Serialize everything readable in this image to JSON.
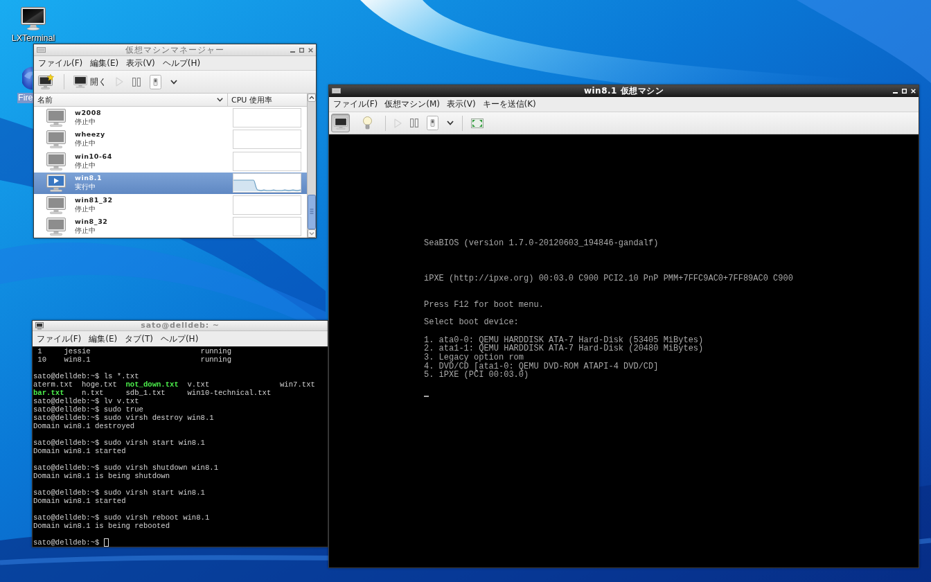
{
  "desktop_icons": [
    {
      "label": "LXTerminal",
      "kind": "terminal",
      "selected": false
    },
    {
      "label": "Fire",
      "kind": "browser",
      "selected": true
    }
  ],
  "vm_manager": {
    "title": "仮想マシンマネージャー",
    "menu": [
      "ファイル(F)",
      "編集(E)",
      "表示(V)",
      "ヘルプ(H)"
    ],
    "toolbar": [
      {
        "kind": "new",
        "disabled": false
      },
      {
        "kind": "open",
        "label": "開く",
        "disabled": false
      },
      {
        "kind": "run",
        "disabled": true
      },
      {
        "kind": "pause",
        "disabled": false
      },
      {
        "kind": "shutdown",
        "disabled": false
      },
      {
        "kind": "menu",
        "disabled": false
      }
    ],
    "columns": [
      "名前",
      "CPU 使用率"
    ],
    "vms": [
      {
        "name": "w2008",
        "status": "停止中",
        "running": false,
        "selected": false
      },
      {
        "name": "wheezy",
        "status": "停止中",
        "running": false,
        "selected": false
      },
      {
        "name": "win10-64",
        "status": "停止中",
        "running": false,
        "selected": false
      },
      {
        "name": "win8.1",
        "status": "実行中",
        "running": true,
        "selected": true
      },
      {
        "name": "win81_32",
        "status": "停止中",
        "running": false,
        "selected": false
      },
      {
        "name": "win8_32",
        "status": "停止中",
        "running": false,
        "selected": false
      }
    ]
  },
  "terminal": {
    "title": "sato@delldeb: ~",
    "menu": [
      "ファイル(F)",
      "編集(E)",
      "タブ(T)",
      "ヘルプ(H)"
    ],
    "blocks": [
      {
        "lines": [
          {
            "kind": "domain",
            "id": "1",
            "name": "jessie",
            "state": "running"
          },
          {
            "kind": "domain",
            "id": "10",
            "name": "win8.1",
            "state": "running"
          }
        ]
      },
      {
        "lines": [
          {
            "kind": "text",
            "text": "sato@delldeb:~$ ls *.txt"
          },
          {
            "kind": "listing",
            "files": [
              {
                "name": "aterm.txt",
                "executable": false
              },
              {
                "name": "hoge.txt",
                "executable": false
              },
              {
                "name": "not_down.txt",
                "executable": true
              },
              {
                "name": "v.txt",
                "executable": false
              },
              {
                "name": "win7.txt",
                "executable": false
              }
            ]
          },
          {
            "kind": "listing",
            "files": [
              {
                "name": "bar.txt",
                "executable": true
              },
              {
                "name": "n.txt",
                "executable": false
              },
              {
                "name": "sdb_1.txt",
                "executable": false
              },
              {
                "name": "win10-technical.txt",
                "executable": false
              }
            ]
          },
          {
            "kind": "text",
            "text": "sato@delldeb:~$ lv v.txt"
          },
          {
            "kind": "text",
            "text": "sato@delldeb:~$ sudo true"
          },
          {
            "kind": "text",
            "text": "sato@delldeb:~$ sudo virsh destroy win8.1"
          },
          {
            "kind": "text",
            "text": "Domain win8.1 destroyed"
          }
        ]
      },
      {
        "lines": [
          {
            "kind": "text",
            "text": "sato@delldeb:~$ sudo virsh start win8.1"
          },
          {
            "kind": "text",
            "text": "Domain win8.1 started"
          }
        ]
      },
      {
        "lines": [
          {
            "kind": "text",
            "text": "sato@delldeb:~$ sudo virsh shutdown win8.1"
          },
          {
            "kind": "text",
            "text": "Domain win8.1 is being shutdown"
          }
        ]
      },
      {
        "lines": [
          {
            "kind": "text",
            "text": "sato@delldeb:~$ sudo virsh start win8.1"
          },
          {
            "kind": "text",
            "text": "Domain win8.1 started"
          }
        ]
      },
      {
        "lines": [
          {
            "kind": "text",
            "text": "sato@delldeb:~$ sudo virsh reboot win8.1"
          },
          {
            "kind": "text",
            "text": "Domain win8.1 is being rebooted"
          }
        ]
      },
      {
        "lines": [
          {
            "kind": "input",
            "text": "sato@delldeb:~$",
            "cursor": true
          }
        ]
      }
    ]
  },
  "vm_viewer": {
    "title": "win8.1 仮想マシン",
    "menu": [
      "ファイル(F)",
      "仮想マシン(M)",
      "表示(V)",
      "キーを送信(K)"
    ],
    "view_buttons": [
      {
        "kind": "console",
        "selected": true
      },
      {
        "kind": "details",
        "selected": false
      }
    ],
    "toolbar": [
      {
        "kind": "run",
        "disabled": true
      },
      {
        "kind": "pause",
        "disabled": false
      },
      {
        "kind": "shutdown",
        "disabled": false
      },
      {
        "kind": "menu",
        "disabled": false
      },
      {
        "kind": "fullscreen",
        "disabled": false
      }
    ],
    "bios": {
      "groups": [
        [
          "SeaBIOS (version 1.7.0-20120603_194846-gandalf)"
        ],
        [
          "iPXE (http://ipxe.org) 00:03.0 C900 PCI2.10 PnP PMM+7FFC9AC0+7FF89AC0 C900"
        ],
        [
          "Press F12 for boot menu."
        ],
        [
          "Select boot device:"
        ],
        [
          "1. ata0-0: QEMU HARDDISK ATA-7 Hard-Disk (53405 MiBytes)",
          "2. ata1-1: QEMU HARDDISK ATA-7 Hard-Disk (20480 MiBytes)",
          "3. Legacy option rom",
          "4. DVD/CD [ata1-0: QEMU DVD-ROM ATAPI-4 DVD/CD]",
          "5. iPXE (PCI 00:03.0)"
        ]
      ],
      "cursor": true
    }
  }
}
